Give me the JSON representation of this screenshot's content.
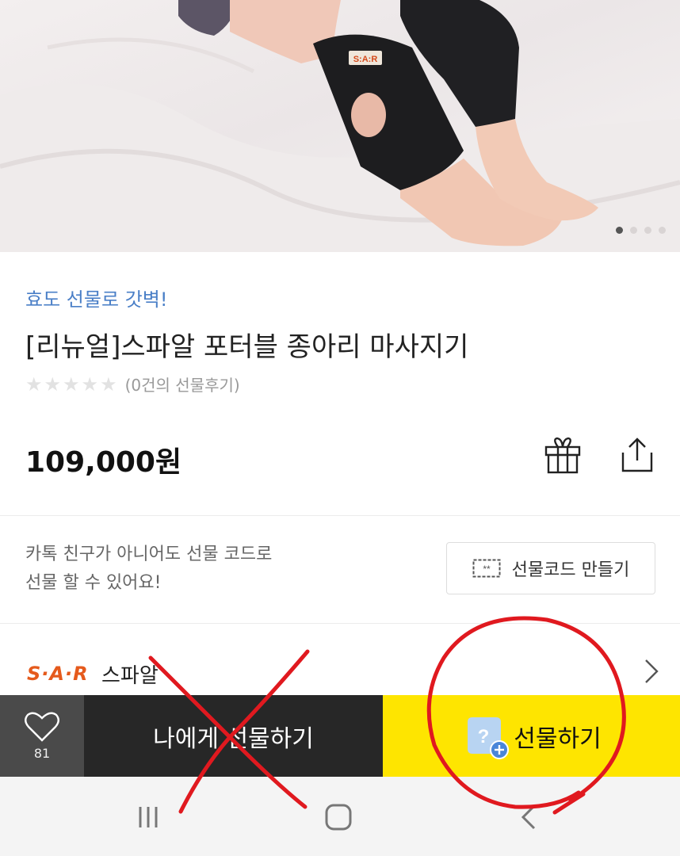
{
  "hero": {
    "image_alt": "spa-al portable calf massager on legs",
    "brand_patch": "S:A:R",
    "carousel_total": 4,
    "carousel_active": 1
  },
  "product": {
    "tagline": "효도 선물로 갓벽!",
    "title": "[리뉴얼]스파알 포터블 종아리 마사지기",
    "rating_stars": 0,
    "reviews_text": "(0건의 선물후기)",
    "price": "109,000원"
  },
  "gift_code": {
    "description_line1": "카톡 친구가 아니어도 선물 코드로",
    "description_line2": "선물 할 수 있어요!",
    "button_label": "선물코드 만들기"
  },
  "seller": {
    "logo_text": "S·A·R",
    "name": "스파알"
  },
  "bottom_bar": {
    "like_count": "81",
    "self_gift_label": "나에게 선물하기",
    "gift_label": "선물하기"
  },
  "colors": {
    "accent_yellow": "#fee500",
    "dark_button": "#272727",
    "like_bg": "#4a4a4a",
    "tagline_blue": "#4a7fc7",
    "annotation_red": "#e0191f",
    "seller_orange": "#e55a1c"
  },
  "icons": {
    "like": "heart-icon",
    "gift": "gift-box-icon",
    "share": "share-icon",
    "code": "ticket-icon",
    "chevron": "chevron-right-icon",
    "gift_badge": "question-plus-icon",
    "nav_recent": "recent-apps-icon",
    "nav_home": "home-icon",
    "nav_back": "back-icon"
  }
}
